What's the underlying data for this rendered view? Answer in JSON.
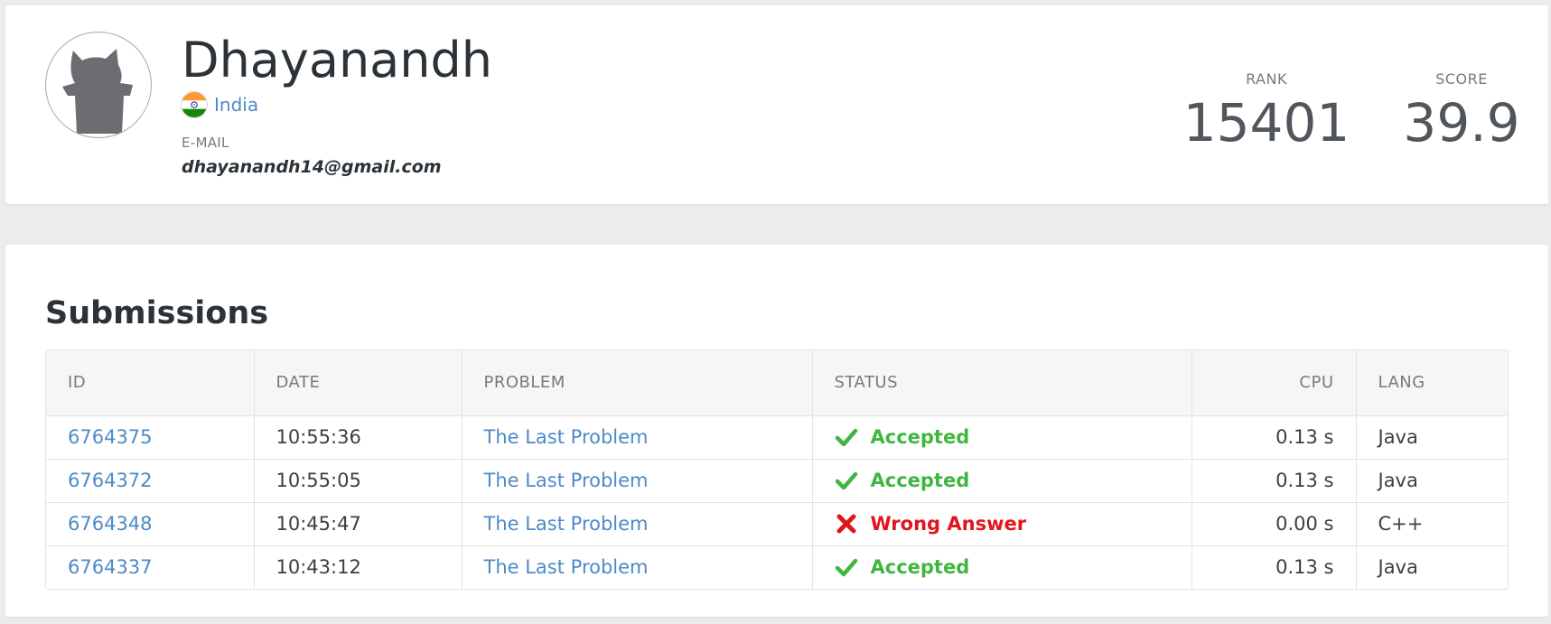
{
  "profile": {
    "name": "Dhayanandh",
    "country": "India",
    "email_label": "E-MAIL",
    "email": "dhayanandh14@gmail.com",
    "avatar_icon": "cat-silhouette-icon",
    "flag_icon": "india-flag-icon",
    "rank_label": "RANK",
    "rank": "15401",
    "score_label": "SCORE",
    "score": "39.9"
  },
  "submissions": {
    "title": "Submissions",
    "columns": [
      "ID",
      "DATE",
      "PROBLEM",
      "STATUS",
      "CPU",
      "LANG"
    ],
    "rows": [
      {
        "id": "6764375",
        "date": "10:55:36",
        "problem": "The Last Problem",
        "status": "Accepted",
        "status_icon": "check-icon",
        "cpu": "0.13 s",
        "lang": "Java"
      },
      {
        "id": "6764372",
        "date": "10:55:05",
        "problem": "The Last Problem",
        "status": "Accepted",
        "status_icon": "check-icon",
        "cpu": "0.13 s",
        "lang": "Java"
      },
      {
        "id": "6764348",
        "date": "10:45:47",
        "problem": "The Last Problem",
        "status": "Wrong Answer",
        "status_icon": "cross-icon",
        "cpu": "0.00 s",
        "lang": "C++"
      },
      {
        "id": "6764337",
        "date": "10:43:12",
        "problem": "The Last Problem",
        "status": "Accepted",
        "status_icon": "check-icon",
        "cpu": "0.13 s",
        "lang": "Java"
      }
    ]
  },
  "colors": {
    "link": "#4e8ac8",
    "accepted": "#3fb73f",
    "wrong": "#e0161e",
    "background": "#ececec"
  }
}
